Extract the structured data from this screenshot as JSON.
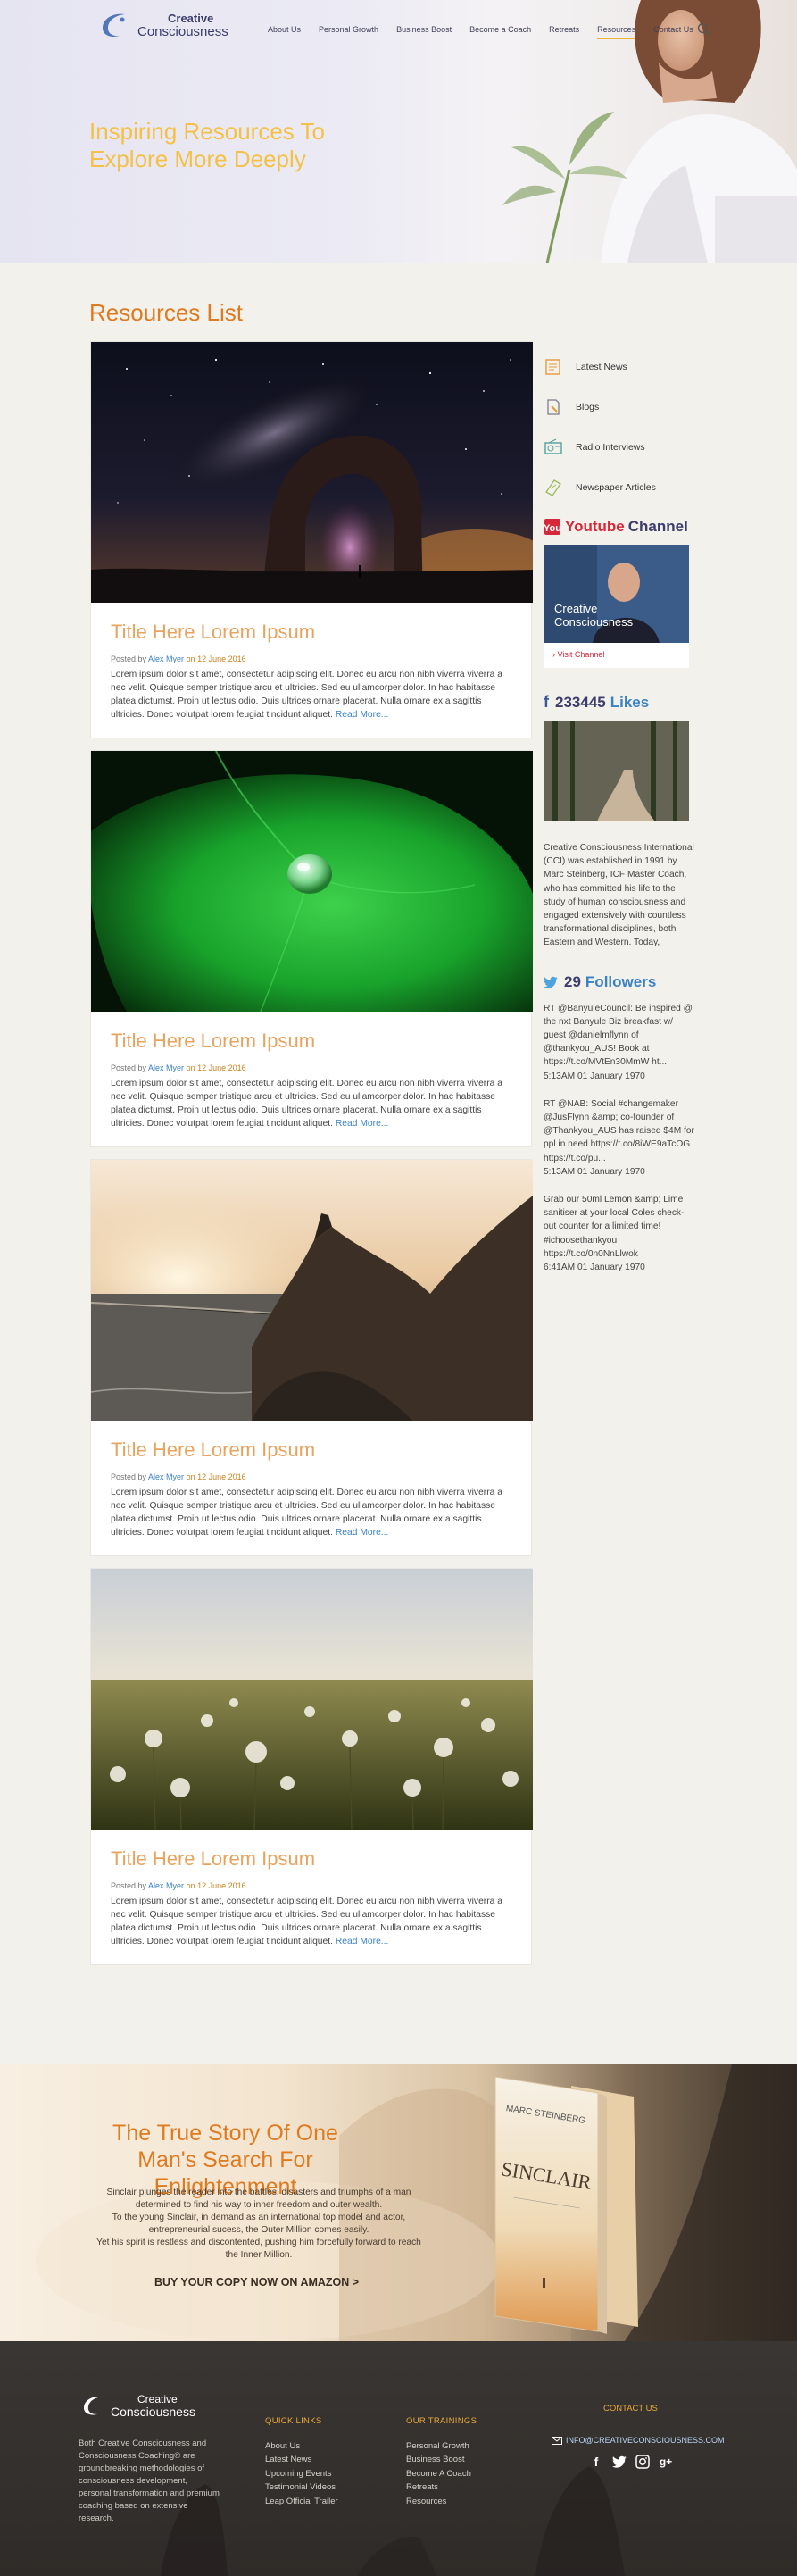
{
  "nav": {
    "logo_line1": "Creative",
    "logo_line2": "Consciousness",
    "items": [
      {
        "label": "About Us"
      },
      {
        "label": "Personal Growth"
      },
      {
        "label": "Business Boost"
      },
      {
        "label": "Become a Coach"
      },
      {
        "label": "Retreats"
      },
      {
        "label": "Resources",
        "active": true
      },
      {
        "label": "Contact Us"
      }
    ],
    "search_icon": "search-icon"
  },
  "hero": {
    "title_line1": "Inspiring Resources To",
    "title_line2": "Explore More Deeply"
  },
  "main": {
    "section_title": "Resources List",
    "posts": [
      {
        "title": "Title Here Lorem Ipsum",
        "posted_by": "Posted by",
        "author": "Alex Myer",
        "on": "on",
        "date": "12 June 2016",
        "excerpt": "Lorem ipsum dolor sit amet, consectetur adipiscing elit. Donec eu arcu non nibh viverra viverra a nec velit. Quisque semper tristique arcu et ultricies. Sed eu ullamcorper dolor. In hac habitasse platea dictumst. Proin ut lectus odio. Duis ultrices ornare placerat. Nulla ornare ex a sagittis ultricies. Donec volutpat lorem feugiat tincidunt aliquet.",
        "read_more": "Read More...",
        "image": "night-sky-arch"
      },
      {
        "title": "Title Here Lorem Ipsum",
        "posted_by": "Posted by",
        "author": "Alex Myer",
        "on": "on",
        "date": "12 June 2016",
        "excerpt": "Lorem ipsum dolor sit amet, consectetur adipiscing elit. Donec eu arcu non nibh viverra viverra a nec velit. Quisque semper tristique arcu et ultricies. Sed eu ullamcorper dolor. In hac habitasse platea dictumst. Proin ut lectus odio. Duis ultrices ornare placerat. Nulla ornare ex a sagittis ultricies. Donec volutpat lorem feugiat tincidunt aliquet.",
        "read_more": "Read More...",
        "image": "green-leaf-droplet"
      },
      {
        "title": "Title Here Lorem Ipsum",
        "posted_by": "Posted by",
        "author": "Alex Myer",
        "on": "on",
        "date": "12 June 2016",
        "excerpt": "Lorem ipsum dolor sit amet, consectetur adipiscing elit. Donec eu arcu non nibh viverra viverra a nec velit. Quisque semper tristique arcu et ultricies. Sed eu ullamcorper dolor. In hac habitasse platea dictumst. Proin ut lectus odio. Duis ultrices ornare placerat. Nulla ornare ex a sagittis ultricies. Donec volutpat lorem feugiat tincidunt aliquet.",
        "read_more": "Read More...",
        "image": "coastal-cliff-sunset"
      },
      {
        "title": "Title Here Lorem Ipsum",
        "posted_by": "Posted by",
        "author": "Alex Myer",
        "on": "on",
        "date": "12 June 2016",
        "excerpt": "Lorem ipsum dolor sit amet, consectetur adipiscing elit. Donec eu arcu non nibh viverra viverra a nec velit. Quisque semper tristique arcu et ultricies. Sed eu ullamcorper dolor. In hac habitasse platea dictumst. Proin ut lectus odio. Duis ultrices ornare placerat. Nulla ornare ex a sagittis ultricies. Donec volutpat lorem feugiat tincidunt aliquet.",
        "read_more": "Read More...",
        "image": "dandelion-field"
      }
    ]
  },
  "sidebar": {
    "categories": [
      {
        "label": "Latest News",
        "icon": "news-icon"
      },
      {
        "label": "Blogs",
        "icon": "blog-icon"
      },
      {
        "label": "Radio Interviews",
        "icon": "radio-icon"
      },
      {
        "label": "Newspaper Articles",
        "icon": "newspaper-icon"
      }
    ],
    "youtube": {
      "label_red": "Youtube",
      "label_dark": "Channel",
      "thumb_line1": "Creative",
      "thumb_line2": "Consciousness",
      "link": "› Visit Channel"
    },
    "facebook": {
      "count": "233445",
      "label": "Likes",
      "text": "Creative Consciousness International (CCI) was established in 1991 by Marc Steinberg, ICF Master Coach, who has committed his life to the study of human consciousness and engaged extensively with countless transformational disciplines, both Eastern and Western. Today,"
    },
    "twitter": {
      "count": "29",
      "label": "Followers",
      "tweets": [
        {
          "text": "RT @BanyuleCouncil: Be inspired @ the nxt Banyule Biz breakfast w/ guest @danielmflynn of @thankyou_AUS! Book at https://t.co/MVtEn30MmW ht...",
          "time": "5:13AM 01 January 1970"
        },
        {
          "text": "RT @NAB: Social #changemaker @JusFlynn &amp; co-founder of @Thankyou_AUS has raised $4M for ppl in need https://t.co/8iWE9aTcOG https://t.co/pu...",
          "time": "5:13AM 01 January 1970"
        },
        {
          "text": "Grab our 50ml Lemon &amp; Lime sanitiser at your local Coles check-out counter for a limited time! #ichoosethankyou https://t.co/0n0NnLlwok",
          "time": "6:41AM 01 January 1970"
        }
      ]
    }
  },
  "book": {
    "title": "The True Story Of One Man's Search For Enlightenment",
    "desc_1": "Sinclair plunges the reader into the battles, disasters and triumphs of a man determined to find his way to inner freedom and outer wealth.",
    "desc_2": "To the young Sinclair, in demand as an international top model and actor, entrepreneurial sucess, the Outer Million comes easily.",
    "desc_3": "Yet his spirit is restless and discontented, pushing him forcefully forward to reach the Inner Million.",
    "cta": "BUY YOUR COPY NOW ON AMAZON  >",
    "cover_author": "MARC STEINBERG",
    "cover_title": "SINCLAIR",
    "cover_sub": "THE TRUE STORY OF ONE MAN'S SEARCH FOR ENLIGHTENMENT"
  },
  "footer": {
    "logo_line1": "Creative",
    "logo_line2": "Consciousness",
    "about": "Both Creative Consciousness and Consciousness Coaching® are groundbreaking methodologies of consciousness development, personal transformation and premium coaching based on extensive research.",
    "quick_title": "QUICK LINKS",
    "quick_links": [
      "About Us",
      "Latest News",
      "Upcoming Events",
      "Testimonial Videos",
      "Leap Official Trailer"
    ],
    "train_title": "OUR TRAININGS",
    "trainings": [
      "Personal Growth",
      "Business Boost",
      "Become A Coach",
      "Retreats",
      "Resources"
    ],
    "contact_title": "CONTACT US",
    "email": "INFO@CREATIVECONSCIOUSNESS.COM",
    "social": [
      "facebook-icon",
      "twitter-icon",
      "instagram-icon",
      "google-plus-icon"
    ]
  },
  "colors": {
    "accent_orange": "#e07a1f",
    "hero_yellow": "#f4c146",
    "link_blue": "#3b82c4",
    "youtube_red": "#d6283a",
    "navy": "#3c3d6e"
  }
}
